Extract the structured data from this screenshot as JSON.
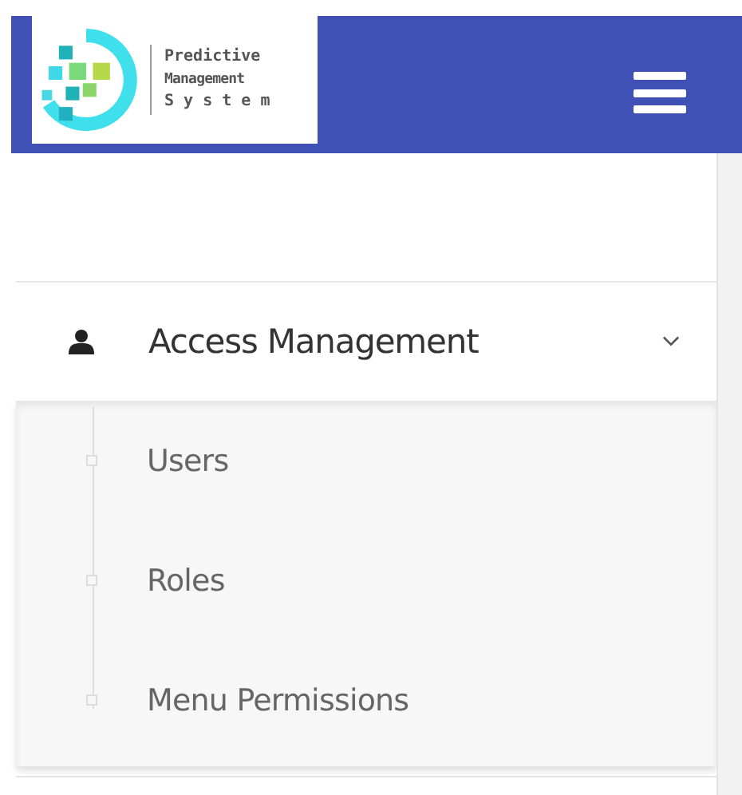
{
  "header": {
    "logo_lines": [
      "Predictive",
      "Management",
      "S y s t e m"
    ]
  },
  "menu": [
    {
      "label": "Access Management",
      "expanded": true,
      "children": [
        {
          "label": "Users"
        },
        {
          "label": "Roles"
        },
        {
          "label": "Menu Permissions"
        }
      ]
    }
  ]
}
